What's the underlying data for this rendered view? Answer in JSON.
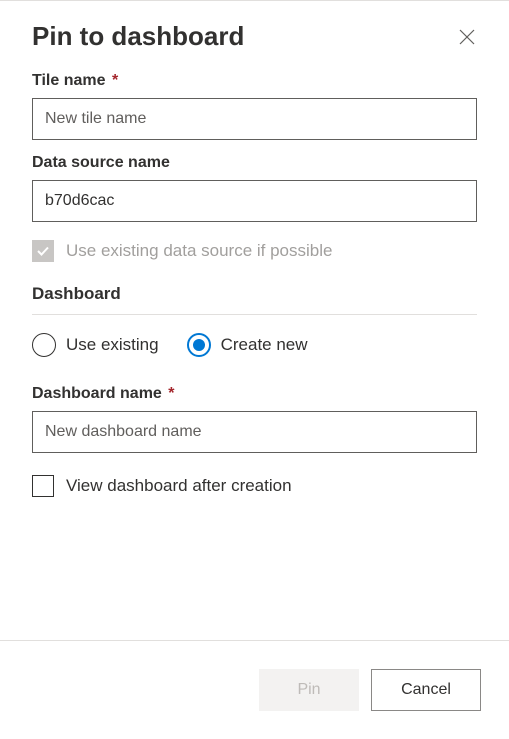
{
  "dialog": {
    "title": "Pin to dashboard"
  },
  "tileName": {
    "label": "Tile name",
    "placeholder": "New tile name",
    "value": ""
  },
  "dataSource": {
    "label": "Data source name",
    "value": "b70d6cac"
  },
  "useExisting": {
    "label": "Use existing data source if possible"
  },
  "dashboardSection": {
    "label": "Dashboard"
  },
  "radioOptions": {
    "existing": "Use existing",
    "createNew": "Create new",
    "selected": "createNew"
  },
  "dashboardName": {
    "label": "Dashboard name",
    "placeholder": "New dashboard name",
    "value": ""
  },
  "viewAfter": {
    "label": "View dashboard after creation"
  },
  "buttons": {
    "pin": "Pin",
    "cancel": "Cancel"
  }
}
